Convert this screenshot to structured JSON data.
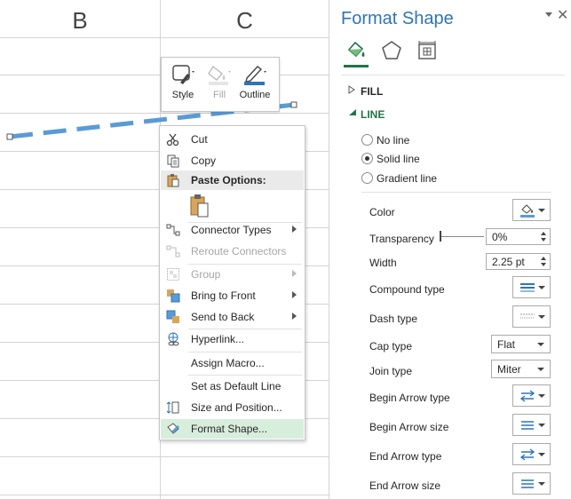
{
  "sheet": {
    "columns": [
      "B",
      "C"
    ]
  },
  "mini_toolbar": {
    "style_label": "Style",
    "fill_label": "Fill",
    "outline_label": "Outline"
  },
  "context_menu": {
    "cut": "Cut",
    "copy": "Copy",
    "paste_options": "Paste Options:",
    "connector_types": "Connector Types",
    "reroute_connectors": "Reroute Connectors",
    "group": "Group",
    "bring_to_front": "Bring to Front",
    "send_to_back": "Send to Back",
    "hyperlink": "Hyperlink...",
    "assign_macro": "Assign Macro...",
    "set_default_line": "Set as Default Line",
    "size_and_position": "Size and Position...",
    "format_shape": "Format Shape..."
  },
  "pane": {
    "title": "Format Shape",
    "close_glyph": "✕",
    "fill_section": "FILL",
    "line_section": "LINE",
    "no_line": "No line",
    "solid_line": "Solid line",
    "gradient_line": "Gradient line",
    "selected_line_option": "Solid line",
    "color_label": "Color",
    "transparency_label": "Transparency",
    "transparency_value": "0%",
    "width_label": "Width",
    "width_value": "2.25 pt",
    "compound_type_label": "Compound type",
    "dash_type_label": "Dash type",
    "cap_type_label": "Cap type",
    "cap_type_value": "Flat",
    "join_type_label": "Join type",
    "join_type_value": "Miter",
    "begin_arrow_type_label": "Begin Arrow type",
    "begin_arrow_size_label": "Begin Arrow size",
    "end_arrow_type_label": "End Arrow type",
    "end_arrow_size_label": "End Arrow size"
  },
  "colors": {
    "accent_title": "#2e75b6",
    "line_shape": "#5b9bd5",
    "menu_highlight": "#d8eedd",
    "excel_green": "#217346"
  }
}
